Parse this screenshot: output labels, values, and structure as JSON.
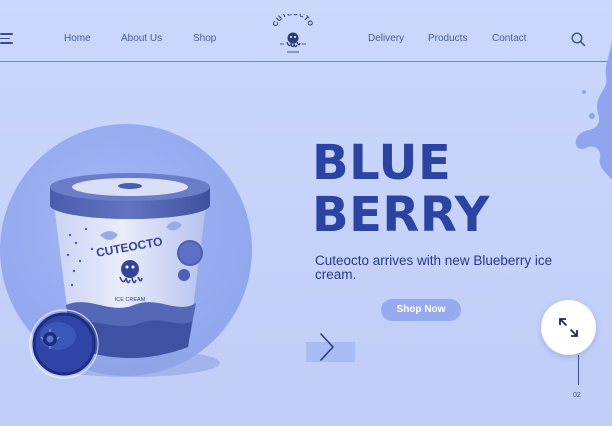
{
  "header": {
    "nav_left": [
      "Home",
      "About Us",
      "Shop"
    ],
    "nav_right": [
      "Delivery",
      "Products",
      "Contact"
    ],
    "logo_text": "CUTEOCTO",
    "icons": {
      "menu": "hamburger-menu-icon",
      "search": "search-icon",
      "logo": "octopus-logo-icon"
    }
  },
  "hero": {
    "title_line1": "BLUE",
    "title_line2": "BERRY",
    "subtitle": "Cuteocto arrives with new Blueberry ice cream.",
    "shop_button": "Shop Now",
    "product_brand": "CUTEOCTO",
    "product_subtitle": "ICE CREAM"
  },
  "slider": {
    "index": "02",
    "icons": {
      "next": "chevron-right-icon",
      "expand": "expand-arrows-icon"
    }
  },
  "colors": {
    "background": "#c7d4fa",
    "accent": "#2b44a3",
    "button": "#97a9ef",
    "text": "#26378a"
  }
}
